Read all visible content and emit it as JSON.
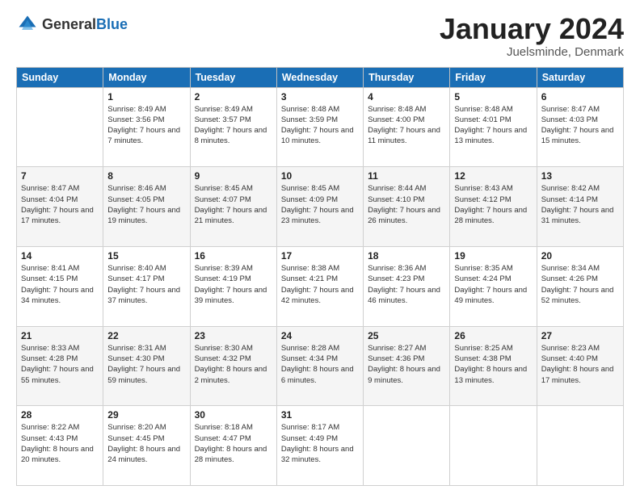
{
  "header": {
    "logo_general": "General",
    "logo_blue": "Blue",
    "title": "January 2024",
    "location": "Juelsminde, Denmark"
  },
  "days_of_week": [
    "Sunday",
    "Monday",
    "Tuesday",
    "Wednesday",
    "Thursday",
    "Friday",
    "Saturday"
  ],
  "weeks": [
    [
      {
        "num": "",
        "sunrise": "",
        "sunset": "",
        "daylight": ""
      },
      {
        "num": "1",
        "sunrise": "Sunrise: 8:49 AM",
        "sunset": "Sunset: 3:56 PM",
        "daylight": "Daylight: 7 hours and 7 minutes."
      },
      {
        "num": "2",
        "sunrise": "Sunrise: 8:49 AM",
        "sunset": "Sunset: 3:57 PM",
        "daylight": "Daylight: 7 hours and 8 minutes."
      },
      {
        "num": "3",
        "sunrise": "Sunrise: 8:48 AM",
        "sunset": "Sunset: 3:59 PM",
        "daylight": "Daylight: 7 hours and 10 minutes."
      },
      {
        "num": "4",
        "sunrise": "Sunrise: 8:48 AM",
        "sunset": "Sunset: 4:00 PM",
        "daylight": "Daylight: 7 hours and 11 minutes."
      },
      {
        "num": "5",
        "sunrise": "Sunrise: 8:48 AM",
        "sunset": "Sunset: 4:01 PM",
        "daylight": "Daylight: 7 hours and 13 minutes."
      },
      {
        "num": "6",
        "sunrise": "Sunrise: 8:47 AM",
        "sunset": "Sunset: 4:03 PM",
        "daylight": "Daylight: 7 hours and 15 minutes."
      }
    ],
    [
      {
        "num": "7",
        "sunrise": "Sunrise: 8:47 AM",
        "sunset": "Sunset: 4:04 PM",
        "daylight": "Daylight: 7 hours and 17 minutes."
      },
      {
        "num": "8",
        "sunrise": "Sunrise: 8:46 AM",
        "sunset": "Sunset: 4:05 PM",
        "daylight": "Daylight: 7 hours and 19 minutes."
      },
      {
        "num": "9",
        "sunrise": "Sunrise: 8:45 AM",
        "sunset": "Sunset: 4:07 PM",
        "daylight": "Daylight: 7 hours and 21 minutes."
      },
      {
        "num": "10",
        "sunrise": "Sunrise: 8:45 AM",
        "sunset": "Sunset: 4:09 PM",
        "daylight": "Daylight: 7 hours and 23 minutes."
      },
      {
        "num": "11",
        "sunrise": "Sunrise: 8:44 AM",
        "sunset": "Sunset: 4:10 PM",
        "daylight": "Daylight: 7 hours and 26 minutes."
      },
      {
        "num": "12",
        "sunrise": "Sunrise: 8:43 AM",
        "sunset": "Sunset: 4:12 PM",
        "daylight": "Daylight: 7 hours and 28 minutes."
      },
      {
        "num": "13",
        "sunrise": "Sunrise: 8:42 AM",
        "sunset": "Sunset: 4:14 PM",
        "daylight": "Daylight: 7 hours and 31 minutes."
      }
    ],
    [
      {
        "num": "14",
        "sunrise": "Sunrise: 8:41 AM",
        "sunset": "Sunset: 4:15 PM",
        "daylight": "Daylight: 7 hours and 34 minutes."
      },
      {
        "num": "15",
        "sunrise": "Sunrise: 8:40 AM",
        "sunset": "Sunset: 4:17 PM",
        "daylight": "Daylight: 7 hours and 37 minutes."
      },
      {
        "num": "16",
        "sunrise": "Sunrise: 8:39 AM",
        "sunset": "Sunset: 4:19 PM",
        "daylight": "Daylight: 7 hours and 39 minutes."
      },
      {
        "num": "17",
        "sunrise": "Sunrise: 8:38 AM",
        "sunset": "Sunset: 4:21 PM",
        "daylight": "Daylight: 7 hours and 42 minutes."
      },
      {
        "num": "18",
        "sunrise": "Sunrise: 8:36 AM",
        "sunset": "Sunset: 4:23 PM",
        "daylight": "Daylight: 7 hours and 46 minutes."
      },
      {
        "num": "19",
        "sunrise": "Sunrise: 8:35 AM",
        "sunset": "Sunset: 4:24 PM",
        "daylight": "Daylight: 7 hours and 49 minutes."
      },
      {
        "num": "20",
        "sunrise": "Sunrise: 8:34 AM",
        "sunset": "Sunset: 4:26 PM",
        "daylight": "Daylight: 7 hours and 52 minutes."
      }
    ],
    [
      {
        "num": "21",
        "sunrise": "Sunrise: 8:33 AM",
        "sunset": "Sunset: 4:28 PM",
        "daylight": "Daylight: 7 hours and 55 minutes."
      },
      {
        "num": "22",
        "sunrise": "Sunrise: 8:31 AM",
        "sunset": "Sunset: 4:30 PM",
        "daylight": "Daylight: 7 hours and 59 minutes."
      },
      {
        "num": "23",
        "sunrise": "Sunrise: 8:30 AM",
        "sunset": "Sunset: 4:32 PM",
        "daylight": "Daylight: 8 hours and 2 minutes."
      },
      {
        "num": "24",
        "sunrise": "Sunrise: 8:28 AM",
        "sunset": "Sunset: 4:34 PM",
        "daylight": "Daylight: 8 hours and 6 minutes."
      },
      {
        "num": "25",
        "sunrise": "Sunrise: 8:27 AM",
        "sunset": "Sunset: 4:36 PM",
        "daylight": "Daylight: 8 hours and 9 minutes."
      },
      {
        "num": "26",
        "sunrise": "Sunrise: 8:25 AM",
        "sunset": "Sunset: 4:38 PM",
        "daylight": "Daylight: 8 hours and 13 minutes."
      },
      {
        "num": "27",
        "sunrise": "Sunrise: 8:23 AM",
        "sunset": "Sunset: 4:40 PM",
        "daylight": "Daylight: 8 hours and 17 minutes."
      }
    ],
    [
      {
        "num": "28",
        "sunrise": "Sunrise: 8:22 AM",
        "sunset": "Sunset: 4:43 PM",
        "daylight": "Daylight: 8 hours and 20 minutes."
      },
      {
        "num": "29",
        "sunrise": "Sunrise: 8:20 AM",
        "sunset": "Sunset: 4:45 PM",
        "daylight": "Daylight: 8 hours and 24 minutes."
      },
      {
        "num": "30",
        "sunrise": "Sunrise: 8:18 AM",
        "sunset": "Sunset: 4:47 PM",
        "daylight": "Daylight: 8 hours and 28 minutes."
      },
      {
        "num": "31",
        "sunrise": "Sunrise: 8:17 AM",
        "sunset": "Sunset: 4:49 PM",
        "daylight": "Daylight: 8 hours and 32 minutes."
      },
      {
        "num": "",
        "sunrise": "",
        "sunset": "",
        "daylight": ""
      },
      {
        "num": "",
        "sunrise": "",
        "sunset": "",
        "daylight": ""
      },
      {
        "num": "",
        "sunrise": "",
        "sunset": "",
        "daylight": ""
      }
    ]
  ]
}
